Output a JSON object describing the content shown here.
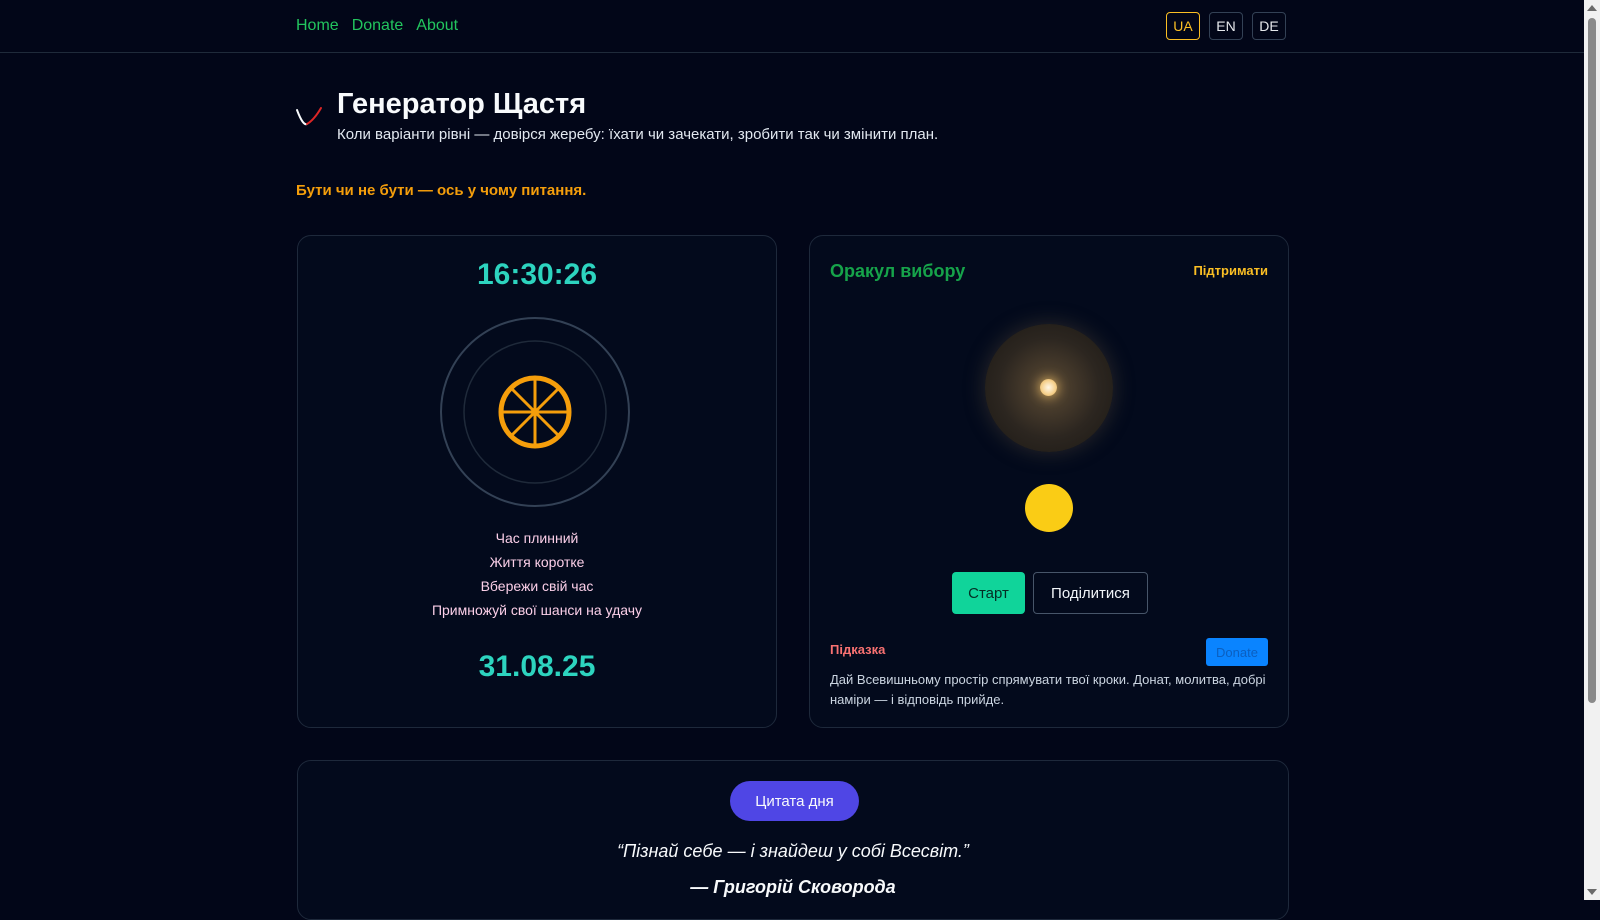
{
  "nav": {
    "links": [
      "Home",
      "Donate",
      "About"
    ],
    "langs": [
      "UA",
      "EN",
      "DE"
    ],
    "active_lang": "UA"
  },
  "header": {
    "title": "Генератор Щастя",
    "subtitle": "Коли варіанти рівні — довірся жеребу: їхати чи зачекати, зробити так чи змінити план."
  },
  "tagline": "Бути чи не бути — ось у чому питання.",
  "clock_card": {
    "time": "16:30:26",
    "lines": [
      "Час плинний",
      "Життя коротке",
      "Вбережи свій час",
      "Примножуй свої шанси на удачу"
    ],
    "date": "31.08.25"
  },
  "oracle_card": {
    "title": "Оракул вибору",
    "support_label": "Підтримати",
    "start_label": "Старт",
    "share_label": "Поділитися",
    "hint_label": "Підказка",
    "donate_label": "Donate",
    "hint_text": "Дай Всевишньому простір спрямувати твої кроки. Донат, молитва, добрі наміри — і відповідь прийде."
  },
  "quote_card": {
    "button_label": "Цитата дня",
    "quote": "“Пізнай себе — і знайдеш у собі Всесвіт.”",
    "author": "— Григорій Сковорода"
  },
  "colors": {
    "accent_green": "#22c55e",
    "teal": "#2dd4bf",
    "gold": "#fbbf24",
    "indigo": "#4f46e5",
    "background": "#020618"
  }
}
